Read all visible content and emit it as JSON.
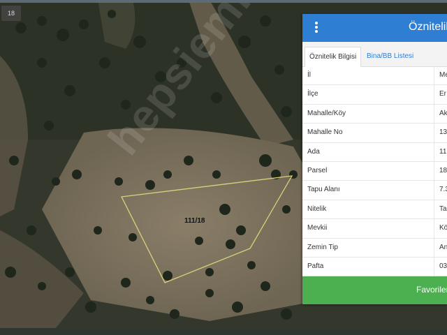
{
  "map": {
    "zoom_badge": "18",
    "parcel_label": "111/18",
    "watermark": "hepsiemlak"
  },
  "panel": {
    "title": "Öznitelik Bilgisi",
    "tabs": [
      {
        "label": "Öznitelik Bilgisi",
        "active": true
      },
      {
        "label": "Bina/BB Listesi",
        "active": false
      }
    ],
    "rows": [
      {
        "key": "İl",
        "value": "Me"
      },
      {
        "key": "İlçe",
        "value": "Er"
      },
      {
        "key": "Mahalle/Köy",
        "value": "Ak"
      },
      {
        "key": "Mahalle No",
        "value": "13"
      },
      {
        "key": "Ada",
        "value": "11"
      },
      {
        "key": "Parsel",
        "value": "18"
      },
      {
        "key": "Tapu Alanı",
        "value": "7.3"
      },
      {
        "key": "Nitelik",
        "value": "Ta"
      },
      {
        "key": "Mevkii",
        "value": "Kö"
      },
      {
        "key": "Zemin Tip",
        "value": "An"
      },
      {
        "key": "Pafta",
        "value": "03"
      }
    ],
    "favorites_label": "Favoriler",
    "colors": {
      "header": "#2e7fd4",
      "favorites": "#4caf50",
      "parcel_outline": "#d8d27a"
    }
  }
}
